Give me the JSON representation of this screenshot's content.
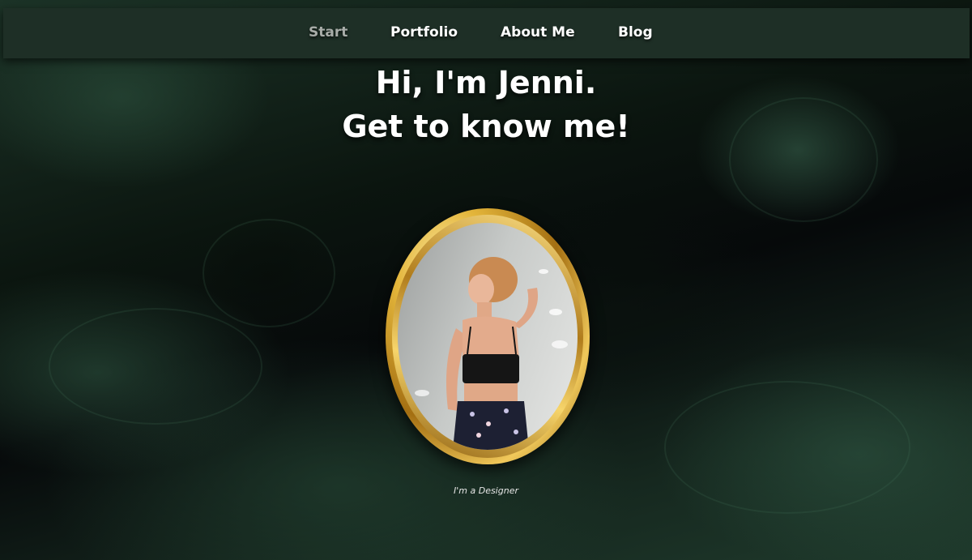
{
  "nav": {
    "items": [
      {
        "label": "Start",
        "active": true
      },
      {
        "label": "Portfolio",
        "active": false
      },
      {
        "label": "About Me",
        "active": false
      },
      {
        "label": "Blog",
        "active": false
      }
    ]
  },
  "hero": {
    "line1": "Hi, I'm Jenni.",
    "line2": "Get to know me!"
  },
  "portrait": {
    "frame_color": "#d4a133"
  },
  "tagline": "I'm a Designer",
  "colors": {
    "nav_background": "#1e2f26",
    "background_dark": "#06090a",
    "background_green": "#1f3a2c",
    "active_nav_text": "#a8aca8",
    "text": "#ffffff"
  }
}
